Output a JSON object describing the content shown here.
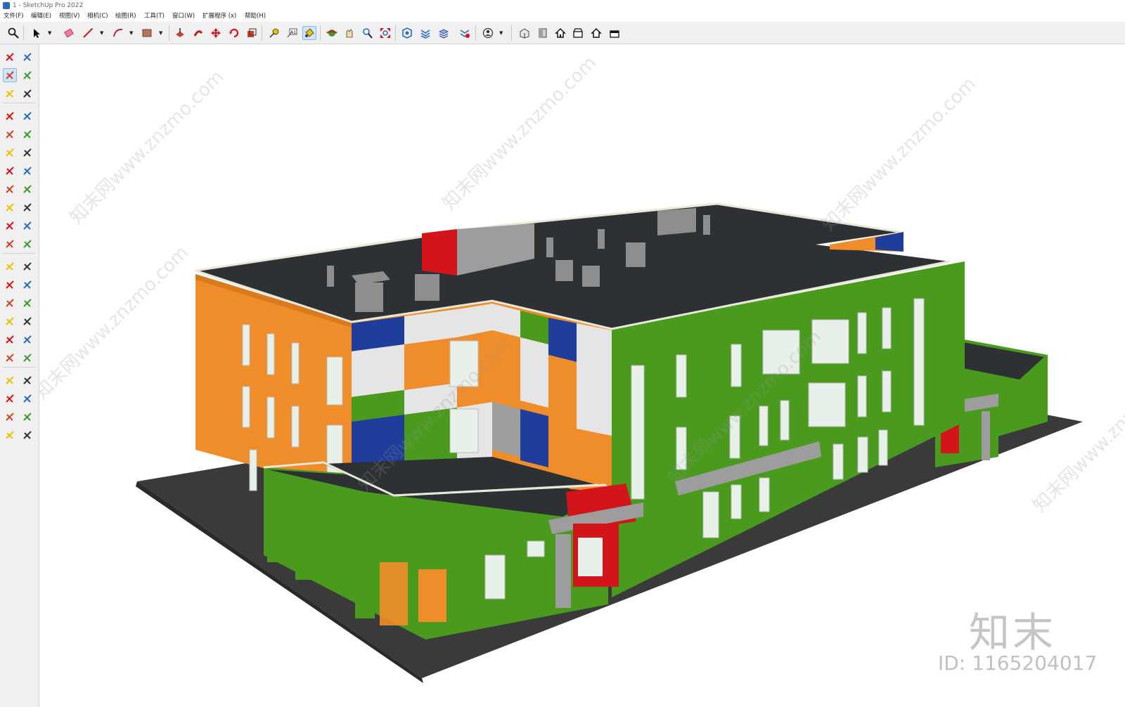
{
  "window": {
    "title": "1 - SketchUp Pro 2022"
  },
  "menu": [
    "文件(F)",
    "编辑(E)",
    "视图(V)",
    "相机(C)",
    "绘图(R)",
    "工具(T)",
    "窗口(W)",
    "扩展程序 (x)",
    "帮助(H)"
  ],
  "toolbar_icons": [
    "zoom-icon",
    "select-icon",
    "eraser-icon",
    "line-icon",
    "arc-icon",
    "rectangle-icon",
    "push-pull-icon",
    "follow-me-icon",
    "move-icon",
    "rotate-icon",
    "scale-icon",
    "tape-measure-icon",
    "text-icon",
    "paint-bucket-icon",
    "orbit-icon",
    "pan-icon",
    "zoom-window-icon",
    "zoom-extents-icon",
    "3d-warehouse-icon",
    "extension-warehouse-icon",
    "layout-icon",
    "extension-manager-icon",
    "account-icon",
    "iso-view-icon",
    "top-view-icon",
    "front-view-icon",
    "right-view-icon",
    "back-view-icon",
    "left-view-icon"
  ],
  "left_tools": [
    "select-icon",
    "orbit-icon",
    "paint-bucket-icon",
    "eraser-icon",
    "component-icon",
    "tag-icon",
    "line-icon",
    "freehand-icon",
    "rectangle-icon",
    "rotated-rectangle-icon",
    "circle-icon",
    "polygon-icon",
    "arc-icon",
    "two-point-arc-icon",
    "three-point-arc-icon",
    "pie-icon",
    "move-icon",
    "push-pull-icon",
    "rotate-icon",
    "follow-me-icon",
    "scale-icon",
    "offset-icon",
    "tape-measure-icon",
    "dimension-icon",
    "protractor-icon",
    "text-icon",
    "axes-icon",
    "3d-text-icon",
    "orbit-icon",
    "pan-icon",
    "zoom-icon",
    "zoom-window-icon",
    "zoom-extents-icon",
    "previous-view-icon",
    "position-camera-icon",
    "look-around-icon",
    "walk-icon",
    "section-plane-icon",
    "3d-warehouse-icon",
    "extension-warehouse-icon",
    "layout-icon",
    "extension-manager-icon"
  ],
  "watermarks": {
    "site": "知末网www.znzmo.com",
    "brand": "知末",
    "id": "ID: 1165204017"
  },
  "colors": {
    "roof": "#2d3133",
    "green": "#4a9a1e",
    "orange": "#ef8d2a",
    "blue": "#1f3d9a",
    "red": "#d3141b",
    "gray": "#9c9d9c",
    "ground": "#3a3a3a"
  }
}
